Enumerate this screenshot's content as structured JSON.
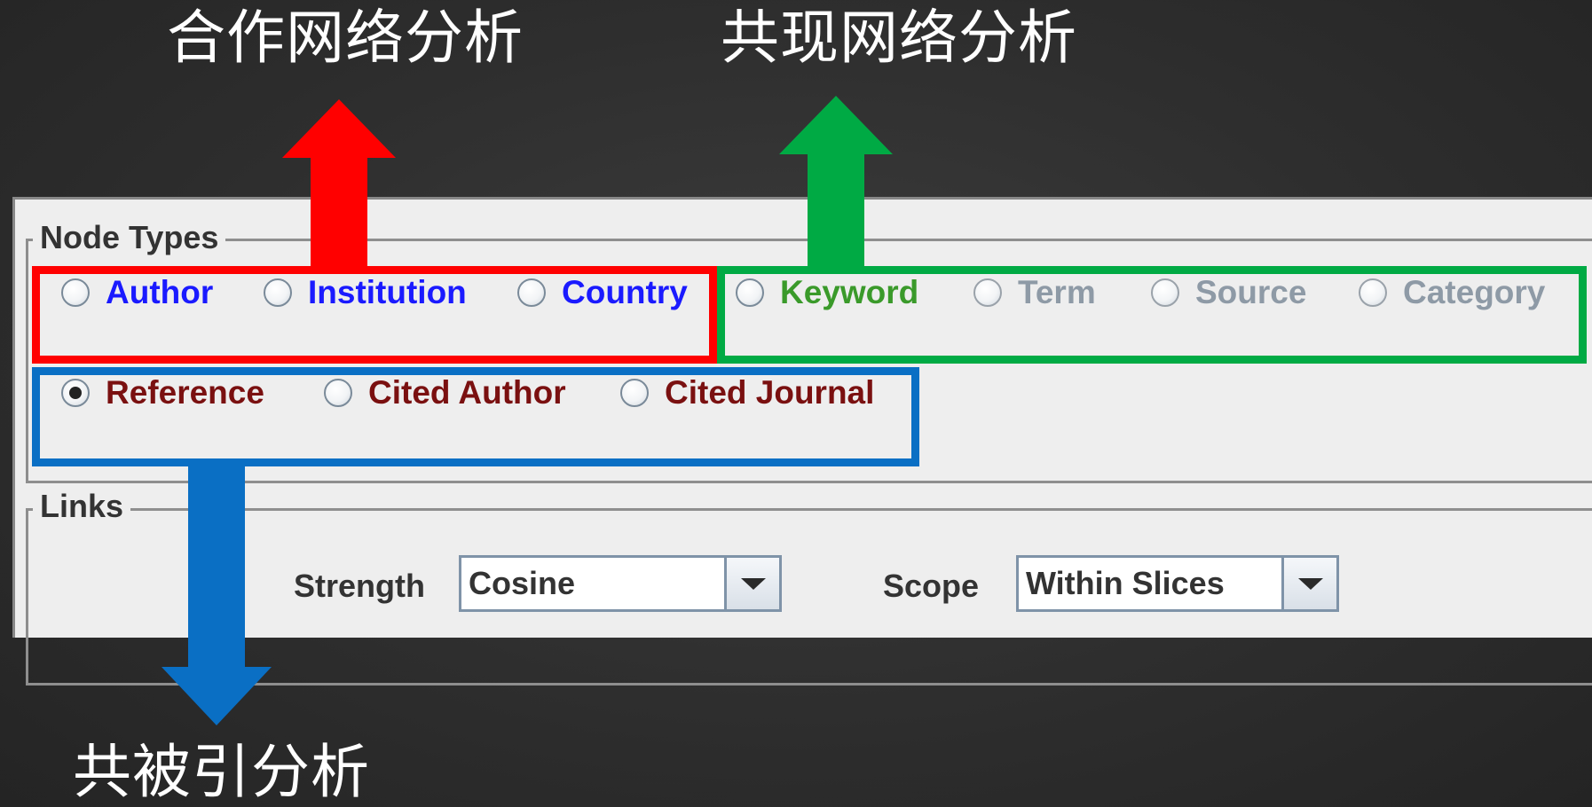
{
  "annotations": {
    "collaboration": "合作网络分析",
    "cooccurrence": "共现网络分析",
    "cocitation": "共被引分析"
  },
  "node_types": {
    "title": "Node Types",
    "selected": "Reference",
    "row1_collaboration": [
      {
        "label": "Author",
        "color": "#1a1aff"
      },
      {
        "label": "Institution",
        "color": "#1a1aff"
      },
      {
        "label": "Country",
        "color": "#1a1aff"
      }
    ],
    "row1_cooccurrence": [
      {
        "label": "Keyword",
        "color": "#3a9a2a"
      },
      {
        "label": "Term",
        "color": "#8e9aa6"
      },
      {
        "label": "Source",
        "color": "#8e9aa6"
      },
      {
        "label": "Category",
        "color": "#8e9aa6"
      }
    ],
    "row2_cocitation": [
      {
        "label": "Reference",
        "color": "#7a1010"
      },
      {
        "label": "Cited Author",
        "color": "#7a1010"
      },
      {
        "label": "Cited Journal",
        "color": "#7a1010"
      }
    ]
  },
  "links": {
    "title": "Links",
    "strength_label": "Strength",
    "strength_value": "Cosine",
    "scope_label": "Scope",
    "scope_value": "Within Slices"
  },
  "colors": {
    "red": "#ff0000",
    "green": "#00aa44",
    "blue": "#0a6fc4"
  }
}
